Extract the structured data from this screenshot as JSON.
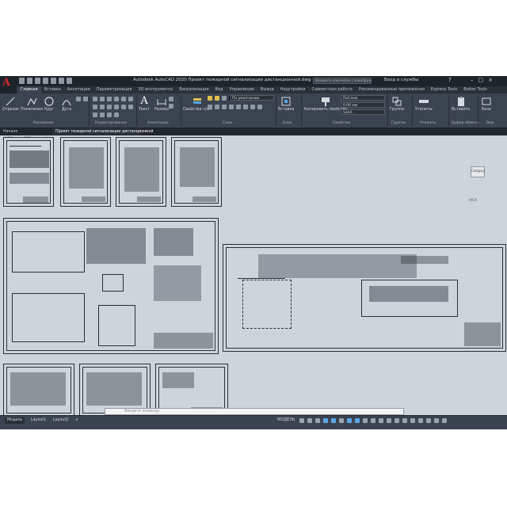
{
  "app_title": "Autodesk AutoCAD 2020   Проект пожарной сигнализации дистанционной.dwg",
  "search_placeholder": "Введите ключевое слово/фразу",
  "sign_in": "Вход в службы",
  "ribbon_tabs": [
    "Главная",
    "Вставка",
    "Аннотации",
    "Параметризация",
    "3D инструменты",
    "Визуализация",
    "Вид",
    "Управление",
    "Вывод",
    "Надстройки",
    "Совместная работа",
    "Рекомендованные приложения",
    "Express Tools",
    "Batter Tools"
  ],
  "ribbon": {
    "draw_buttons": [
      "Отрезок",
      "Полилиния",
      "Круг",
      "Дуга"
    ],
    "text_button": "Текст",
    "dim_button": "Размер",
    "insert_block": "Вставить блок",
    "layer_props": "Свойства слоя",
    "layer_dropdown": "По умолчанию",
    "insert_button": "Вставка",
    "match_props": "Копировать свойства",
    "bylayer_1": "ПоСлою",
    "bylayer_2": "0.00 мм",
    "bylayer_3": "Solid...",
    "group_button": "Группа",
    "utilities_button": "Утилиты",
    "paste_button": "Вставить",
    "base_button": "База",
    "panels": [
      "Рисование",
      "Редактирование",
      "Аннотации",
      "Слои",
      "Блок",
      "Свойства",
      "Группы",
      "Утилиты",
      "Буфер обмена",
      "Вид"
    ]
  },
  "doc_tabs": [
    "Начало",
    "Проект пожарной сигнализации дистанционной"
  ],
  "viewcube_label": "Сверху",
  "wcs_label": "МСК",
  "cmd_placeholder": "Введите команду",
  "layout_tabs": [
    "Модель",
    "Layout1",
    "Layout2"
  ],
  "model_label": "МОДЕЛЬ",
  "sheet_label": "[-][Сверху][2D-каркас]"
}
